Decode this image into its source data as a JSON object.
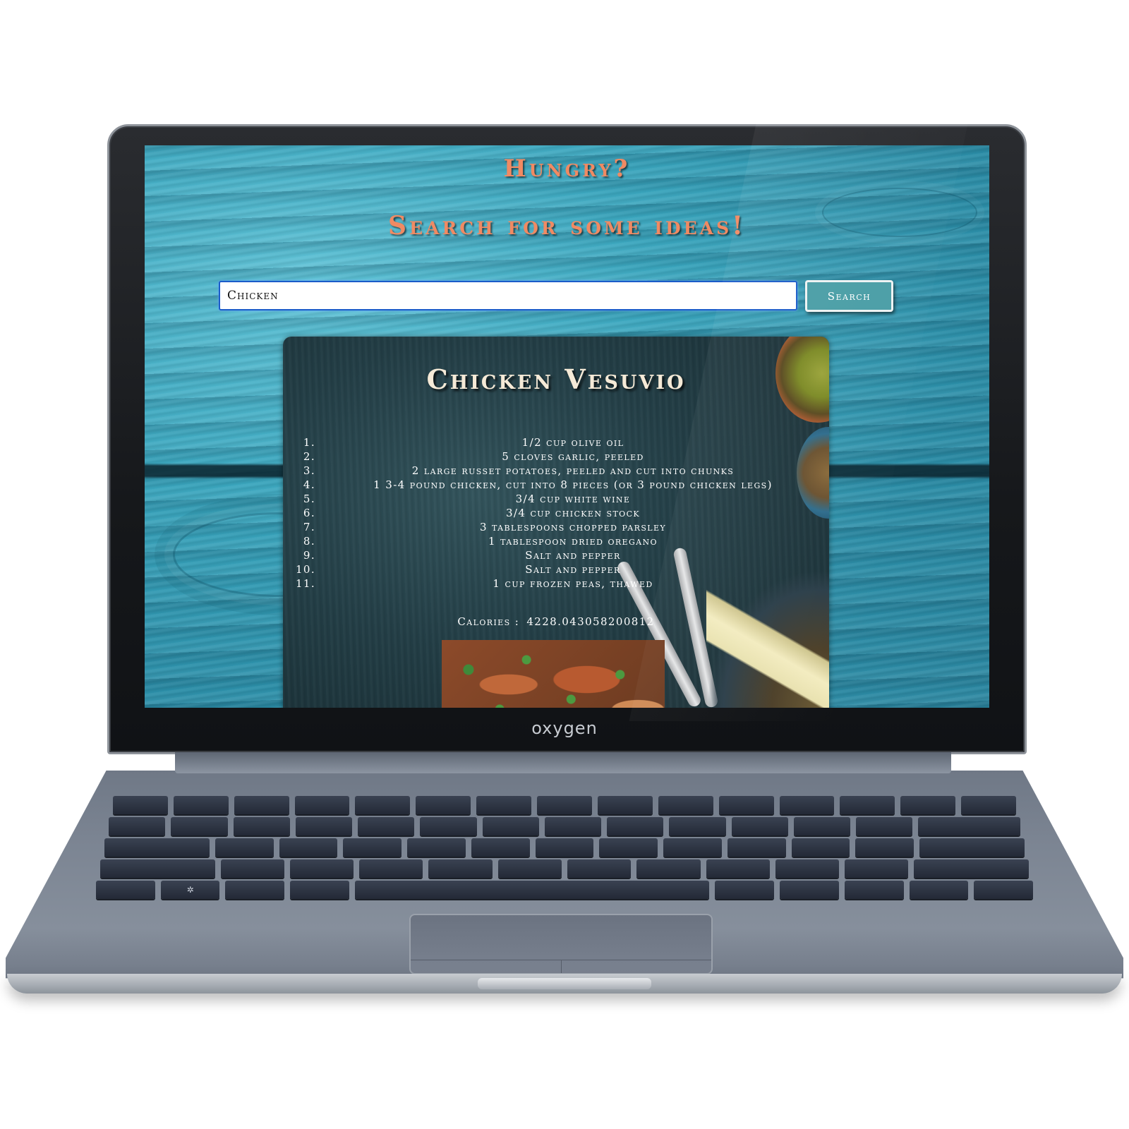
{
  "device": {
    "brand": "oxygen"
  },
  "header": {
    "title": "Hungry?",
    "subtitle": "Search for some ideas!"
  },
  "search": {
    "value": "Chicken",
    "button_label": "Search"
  },
  "recipe": {
    "title": "Chicken Vesuvio",
    "ingredients": [
      {
        "num": "1.",
        "text": "1/2 cup olive oil"
      },
      {
        "num": "2.",
        "text": "5 cloves garlic, peeled"
      },
      {
        "num": "3.",
        "text": "2 large russet potatoes, peeled and cut into chunks"
      },
      {
        "num": "4.",
        "text": "1 3-4 pound chicken, cut into 8 pieces (or 3 pound chicken legs)"
      },
      {
        "num": "5.",
        "text": "3/4 cup white wine"
      },
      {
        "num": "6.",
        "text": "3/4 cup chicken stock"
      },
      {
        "num": "7.",
        "text": "3 tablespoons chopped parsley"
      },
      {
        "num": "8.",
        "text": "1 tablespoon dried oregano"
      },
      {
        "num": "9.",
        "text": "Salt and pepper"
      },
      {
        "num": "10.",
        "text": "Salt and pepper"
      },
      {
        "num": "11.",
        "text": "1 cup frozen peas, thawed"
      }
    ],
    "calories_label": "Calories :",
    "calories_value": "4228.043058200812"
  },
  "colors": {
    "accent_heading": "#f08a63",
    "button": "#4a9ea6",
    "background": "#3aa6be"
  }
}
